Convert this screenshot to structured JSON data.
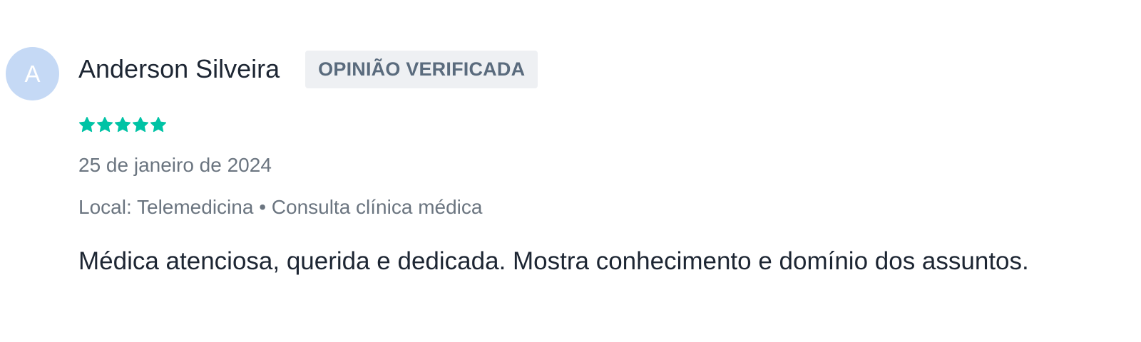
{
  "review": {
    "avatar_initial": "A",
    "reviewer_name": "Anderson Silveira",
    "verified_badge": "OPINIÃO VERIFICADA",
    "rating": 5,
    "rating_max": 5,
    "star_color": "#00c3a5",
    "date": "25 de janeiro de 2024",
    "location": "Local: Telemedicina • Consulta clínica médica",
    "text": "Médica atenciosa, querida e dedicada. Mostra conhecimento e domínio dos assuntos."
  }
}
